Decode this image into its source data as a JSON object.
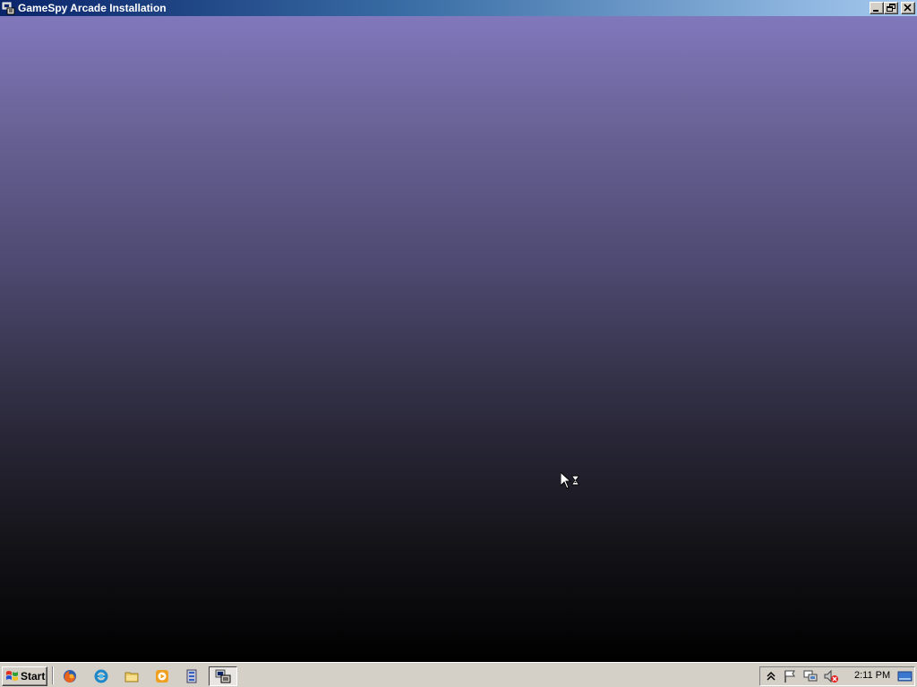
{
  "window": {
    "title": "GameSpy Arcade Installation",
    "app_icon": "installer-app-icon",
    "buttons": [
      "minimize-button",
      "restore-button",
      "close-button"
    ]
  },
  "client": {
    "background_top": "#8078bc",
    "background_bottom": "#000000",
    "cursor": "busy-arrow-hourglass-cursor"
  },
  "taskbar": {
    "start_label": "Start",
    "quick_launch": [
      {
        "name": "firefox-icon"
      },
      {
        "name": "internet-explorer-icon"
      },
      {
        "name": "folder-icon"
      },
      {
        "name": "media-player-icon"
      },
      {
        "name": "server-manager-icon"
      }
    ],
    "active_task_icon": "gamespy-installer-task-icon",
    "tray": {
      "icons": [
        "show-hidden-icons-chevron",
        "action-center-flag-icon",
        "network-icon",
        "volume-muted-icon"
      ],
      "clock": "2:11 PM",
      "show_desktop_icon": "show-desktop-icon"
    }
  },
  "colors": {
    "titlebar_start": "#0a246a",
    "titlebar_end": "#a6caf0",
    "taskbar": "#d4d0c8"
  }
}
